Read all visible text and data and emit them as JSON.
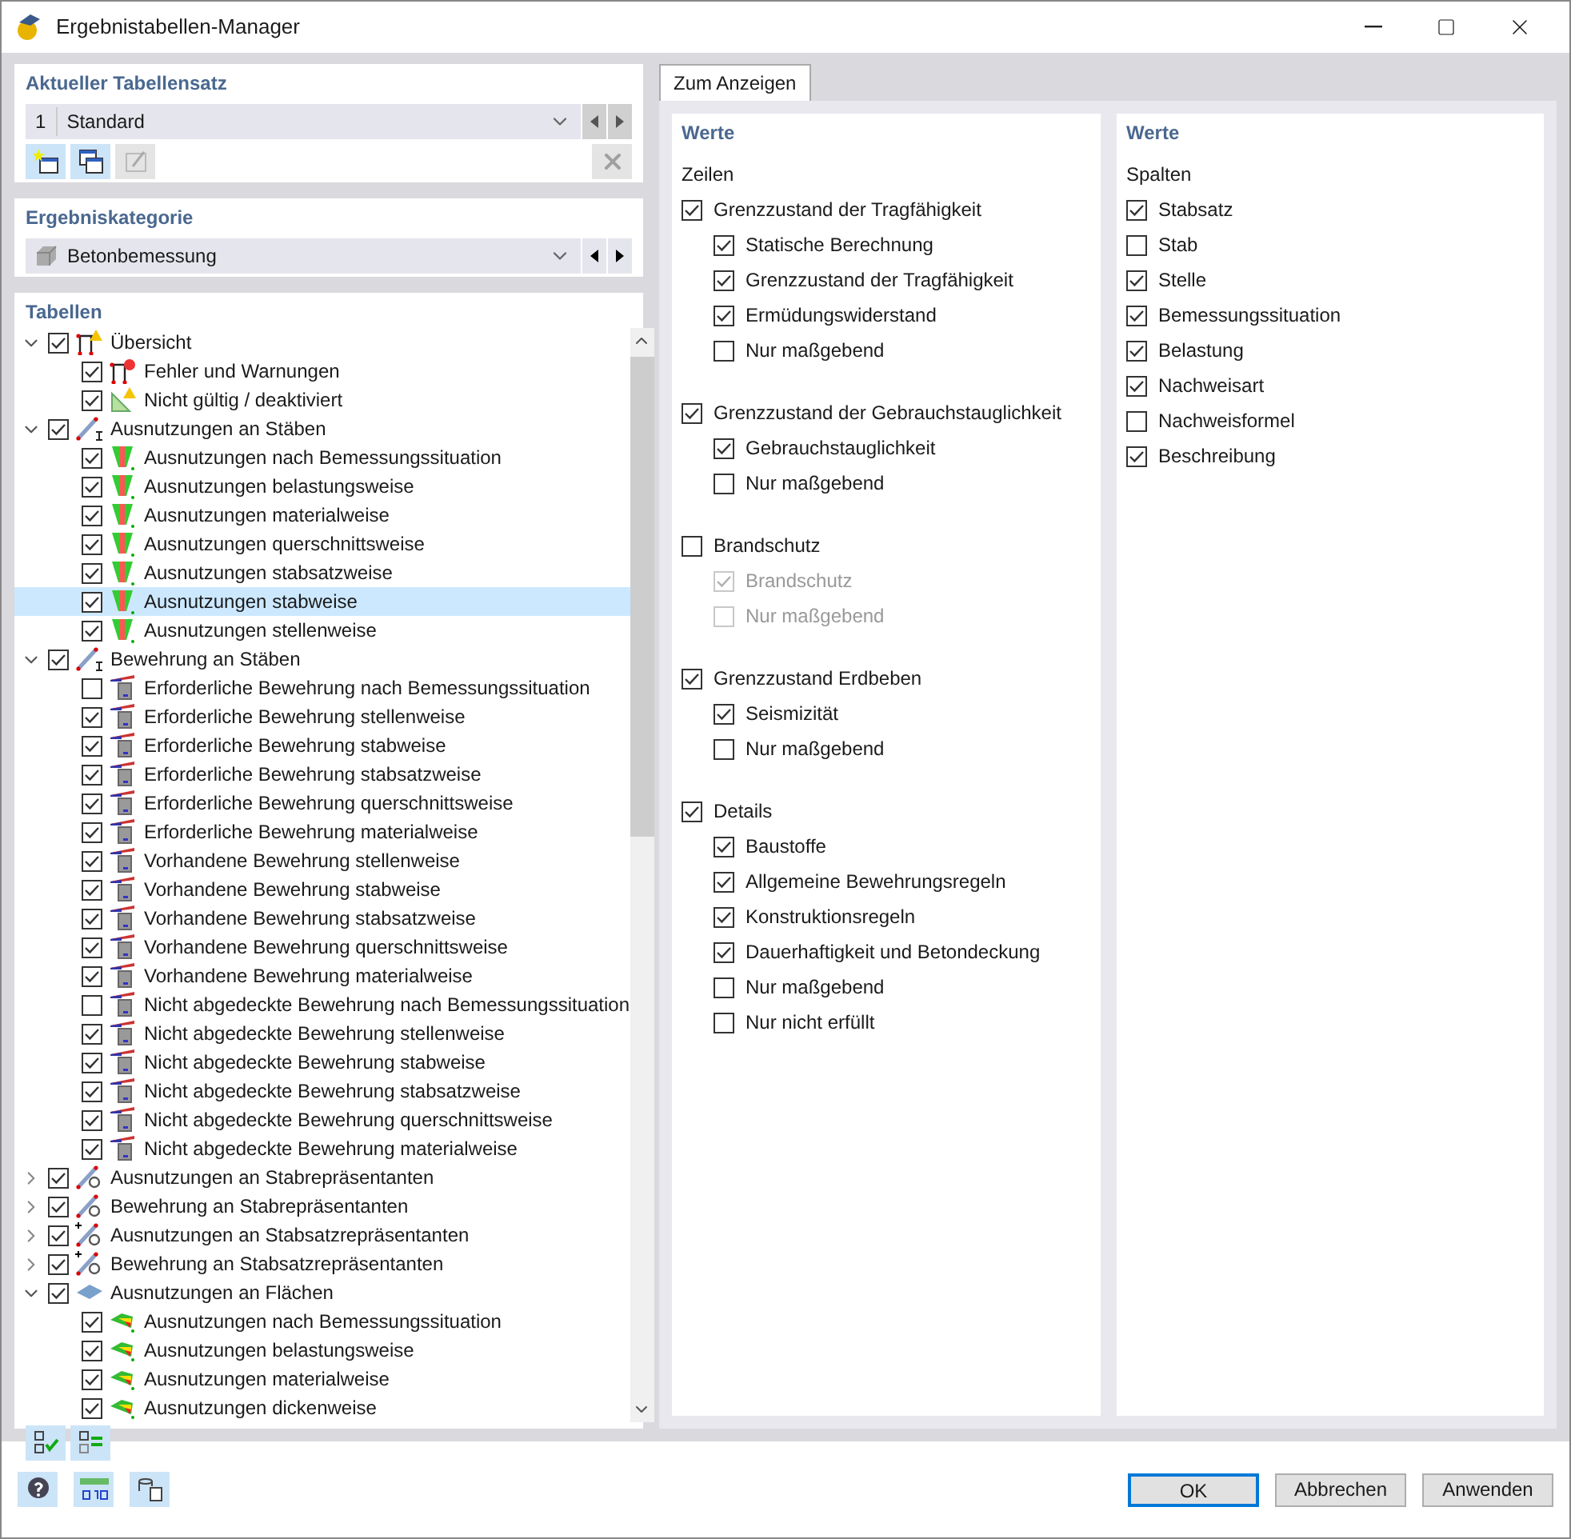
{
  "window": {
    "title": "Ergebnistabellen-Manager"
  },
  "table_set": {
    "heading": "Aktueller Tabellensatz",
    "number": "1",
    "value": "Standard"
  },
  "category": {
    "heading": "Ergebniskategorie",
    "value": "Betonbemessung"
  },
  "tables": {
    "heading": "Tabellen",
    "items": [
      {
        "label": "Übersicht",
        "kind": "overview",
        "checked": true,
        "expanded": true,
        "selected": false,
        "children": [
          {
            "label": "Fehler und Warnungen",
            "kind": "error",
            "checked": true,
            "selected": false
          },
          {
            "label": "Nicht gültig / deaktiviert",
            "kind": "triangle",
            "checked": true,
            "selected": false
          }
        ]
      },
      {
        "label": "Ausnutzungen an Stäben",
        "kind": "member",
        "checked": true,
        "expanded": true,
        "selected": false,
        "children": [
          {
            "label": "Ausnutzungen nach Bemessungssituation",
            "kind": "util",
            "checked": true,
            "selected": false
          },
          {
            "label": "Ausnutzungen belastungsweise",
            "kind": "util",
            "checked": true,
            "selected": false
          },
          {
            "label": "Ausnutzungen materialweise",
            "kind": "util",
            "checked": true,
            "selected": false
          },
          {
            "label": "Ausnutzungen querschnittsweise",
            "kind": "util",
            "checked": true,
            "selected": false
          },
          {
            "label": "Ausnutzungen stabsatzweise",
            "kind": "util",
            "checked": true,
            "selected": false
          },
          {
            "label": "Ausnutzungen stabweise",
            "kind": "util",
            "checked": true,
            "selected": true
          },
          {
            "label": "Ausnutzungen stellenweise",
            "kind": "util",
            "checked": true,
            "selected": false
          }
        ]
      },
      {
        "label": "Bewehrung an Stäben",
        "kind": "member",
        "checked": true,
        "expanded": true,
        "selected": false,
        "children": [
          {
            "label": "Erforderliche Bewehrung nach Bemessungssituation",
            "kind": "rebar",
            "checked": false,
            "selected": false
          },
          {
            "label": "Erforderliche Bewehrung stellenweise",
            "kind": "rebar",
            "checked": true,
            "selected": false
          },
          {
            "label": "Erforderliche Bewehrung stabweise",
            "kind": "rebar",
            "checked": true,
            "selected": false
          },
          {
            "label": "Erforderliche Bewehrung stabsatzweise",
            "kind": "rebar",
            "checked": true,
            "selected": false
          },
          {
            "label": "Erforderliche Bewehrung querschnittsweise",
            "kind": "rebar",
            "checked": true,
            "selected": false
          },
          {
            "label": "Erforderliche Bewehrung materialweise",
            "kind": "rebar",
            "checked": true,
            "selected": false
          },
          {
            "label": "Vorhandene Bewehrung stellenweise",
            "kind": "rebar",
            "checked": true,
            "selected": false
          },
          {
            "label": "Vorhandene Bewehrung stabweise",
            "kind": "rebar",
            "checked": true,
            "selected": false
          },
          {
            "label": "Vorhandene Bewehrung stabsatzweise",
            "kind": "rebar",
            "checked": true,
            "selected": false
          },
          {
            "label": "Vorhandene Bewehrung querschnittsweise",
            "kind": "rebar",
            "checked": true,
            "selected": false
          },
          {
            "label": "Vorhandene Bewehrung materialweise",
            "kind": "rebar",
            "checked": true,
            "selected": false
          },
          {
            "label": "Nicht abgedeckte Bewehrung nach Bemessungssituation",
            "kind": "rebar",
            "checked": false,
            "selected": false
          },
          {
            "label": "Nicht abgedeckte Bewehrung stellenweise",
            "kind": "rebar",
            "checked": true,
            "selected": false
          },
          {
            "label": "Nicht abgedeckte Bewehrung stabweise",
            "kind": "rebar",
            "checked": true,
            "selected": false
          },
          {
            "label": "Nicht abgedeckte Bewehrung stabsatzweise",
            "kind": "rebar",
            "checked": true,
            "selected": false
          },
          {
            "label": "Nicht abgedeckte Bewehrung querschnittsweise",
            "kind": "rebar",
            "checked": true,
            "selected": false
          },
          {
            "label": "Nicht abgedeckte Bewehrung materialweise",
            "kind": "rebar",
            "checked": true,
            "selected": false
          }
        ]
      },
      {
        "label": "Ausnutzungen an Stabrepräsentanten",
        "kind": "link",
        "checked": true,
        "expanded": false,
        "selected": false
      },
      {
        "label": "Bewehrung an Stabrepräsentanten",
        "kind": "link",
        "checked": true,
        "expanded": false,
        "selected": false
      },
      {
        "label": "Ausnutzungen an Stabsatzrepräsentanten",
        "kind": "linkset",
        "checked": true,
        "expanded": false,
        "selected": false
      },
      {
        "label": "Bewehrung an Stabsatzrepräsentanten",
        "kind": "linkset",
        "checked": true,
        "expanded": false,
        "selected": false
      },
      {
        "label": "Ausnutzungen an Flächen",
        "kind": "surface",
        "checked": true,
        "expanded": true,
        "selected": false,
        "children": [
          {
            "label": "Ausnutzungen nach Bemessungssituation",
            "kind": "surfutil",
            "checked": true,
            "selected": false
          },
          {
            "label": "Ausnutzungen belastungsweise",
            "kind": "surfutil",
            "checked": true,
            "selected": false
          },
          {
            "label": "Ausnutzungen materialweise",
            "kind": "surfutil",
            "checked": true,
            "selected": false
          },
          {
            "label": "Ausnutzungen dickenweise",
            "kind": "surfutil",
            "checked": true,
            "selected": false
          }
        ]
      }
    ]
  },
  "tabs": [
    {
      "label": "Zum Anzeigen",
      "selected": true
    }
  ],
  "rows_panel": {
    "heading": "Werte",
    "subheading": "Zeilen",
    "groups": [
      {
        "label": "Grenzzustand der Tragfähigkeit",
        "checked": true,
        "disabled": false,
        "children": [
          {
            "label": "Statische Berechnung",
            "checked": true,
            "disabled": false
          },
          {
            "label": "Grenzzustand der Tragfähigkeit",
            "checked": true,
            "disabled": false
          },
          {
            "label": "Ermüdungswiderstand",
            "checked": true,
            "disabled": false
          },
          {
            "label": "Nur maßgebend",
            "checked": false,
            "disabled": false
          }
        ]
      },
      {
        "label": "Grenzzustand der Gebrauchstauglichkeit",
        "checked": true,
        "disabled": false,
        "children": [
          {
            "label": "Gebrauchstauglichkeit",
            "checked": true,
            "disabled": false
          },
          {
            "label": "Nur maßgebend",
            "checked": false,
            "disabled": false
          }
        ]
      },
      {
        "label": "Brandschutz",
        "checked": false,
        "disabled": false,
        "children": [
          {
            "label": "Brandschutz",
            "checked": true,
            "disabled": true
          },
          {
            "label": "Nur maßgebend",
            "checked": false,
            "disabled": true
          }
        ]
      },
      {
        "label": "Grenzzustand Erdbeben",
        "checked": true,
        "disabled": false,
        "children": [
          {
            "label": "Seismizität",
            "checked": true,
            "disabled": false
          },
          {
            "label": "Nur maßgebend",
            "checked": false,
            "disabled": false
          }
        ]
      },
      {
        "label": "Details",
        "checked": true,
        "disabled": false,
        "children": [
          {
            "label": "Baustoffe",
            "checked": true,
            "disabled": false
          },
          {
            "label": "Allgemeine Bewehrungsregeln",
            "checked": true,
            "disabled": false
          },
          {
            "label": "Konstruktionsregeln",
            "checked": true,
            "disabled": false
          },
          {
            "label": "Dauerhaftigkeit und Betondeckung",
            "checked": true,
            "disabled": false
          },
          {
            "label": "Nur maßgebend",
            "checked": false,
            "disabled": false
          },
          {
            "label": "Nur nicht erfüllt",
            "checked": false,
            "disabled": false
          }
        ]
      }
    ]
  },
  "columns_panel": {
    "heading": "Werte",
    "subheading": "Spalten",
    "items": [
      {
        "label": "Stabsatz",
        "checked": true
      },
      {
        "label": "Stab",
        "checked": false
      },
      {
        "label": "Stelle",
        "checked": true
      },
      {
        "label": "Bemessungssituation",
        "checked": true
      },
      {
        "label": "Belastung",
        "checked": true
      },
      {
        "label": "Nachweisart",
        "checked": true
      },
      {
        "label": "Nachweisformel",
        "checked": false
      },
      {
        "label": "Beschreibung",
        "checked": true
      }
    ]
  },
  "buttons": [
    "OK",
    "Abbrechen",
    "Anwenden"
  ]
}
